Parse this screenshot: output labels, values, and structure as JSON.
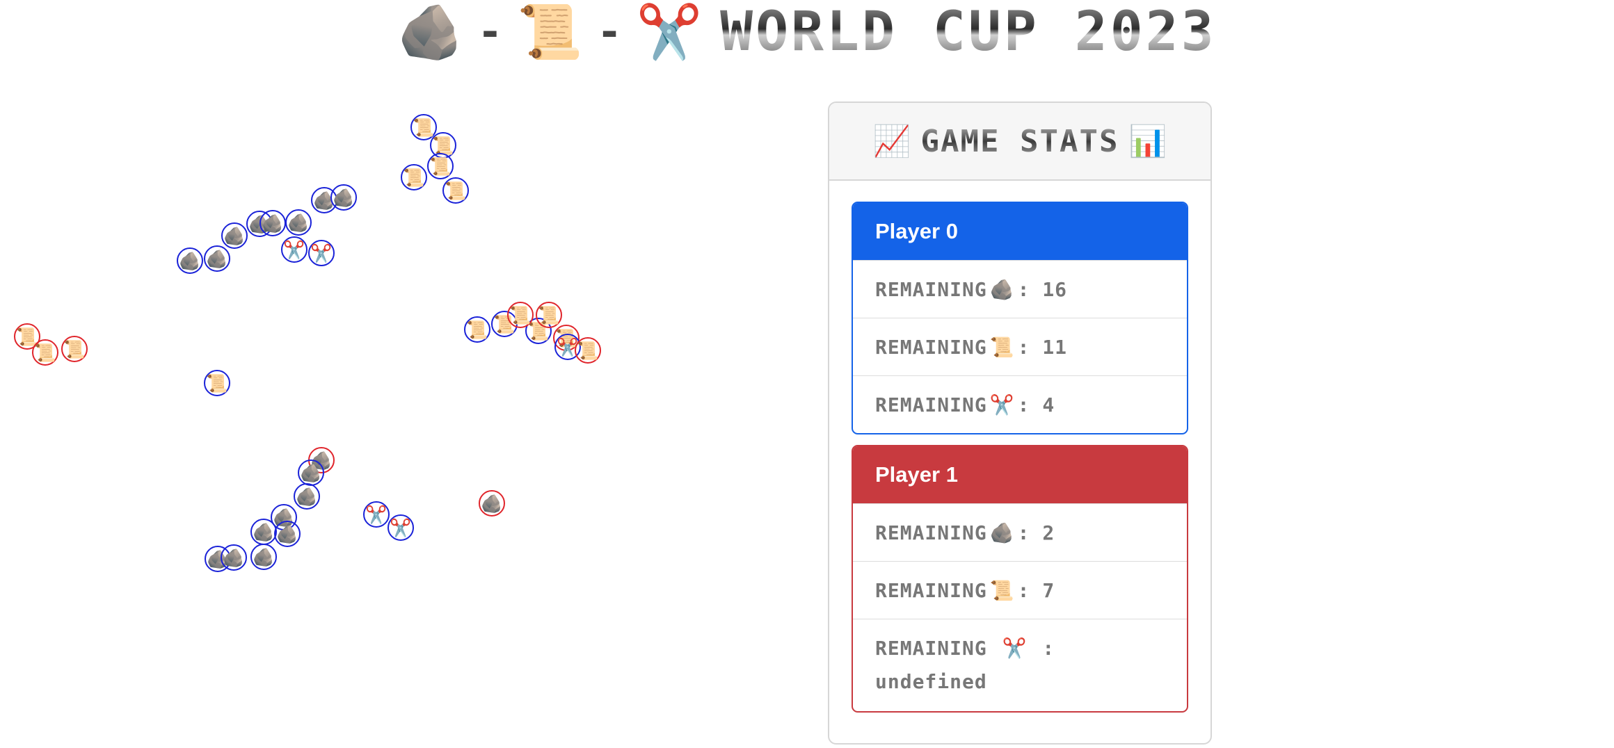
{
  "header": {
    "rock_icon": "🪨",
    "paper_icon": "📜",
    "scissors_icon": "✂️",
    "dash": "-",
    "title_text": "WORLD CUP 2023"
  },
  "stats": {
    "chart_icon": "📈",
    "bars_icon": "📊",
    "title": "GAME STATS",
    "players": [
      {
        "name": "Player 0",
        "color": "#1463e8",
        "rows": [
          {
            "prefix": "REMAINING",
            "icon": "🪨",
            "sep": ":",
            "value": "16"
          },
          {
            "prefix": "REMAINING",
            "icon": "📜",
            "sep": ":",
            "value": "11"
          },
          {
            "prefix": "REMAINING",
            "icon": "✂️",
            "sep": ":",
            "value": "4"
          }
        ]
      },
      {
        "name": "Player 1",
        "color": "#c83a3f",
        "rows": [
          {
            "prefix": "REMAINING",
            "icon": "🪨",
            "sep": ":",
            "value": "2"
          },
          {
            "prefix": "REMAINING",
            "icon": "📜",
            "sep": ":",
            "value": "7"
          },
          {
            "prefix": "REMAINING",
            "icon": "✂️",
            "sep": ":",
            "value": "undefined"
          }
        ]
      }
    ]
  },
  "arena": {
    "player_colors": {
      "p0": "#1a22d8",
      "p1": "#e0252b"
    },
    "pieces": [
      {
        "player": "p0",
        "kind": "rock"
      },
      {
        "player": "p0",
        "kind": "rock"
      },
      {
        "player": "p0",
        "kind": "rock"
      },
      {
        "player": "p0",
        "kind": "rock"
      },
      {
        "player": "p0",
        "kind": "rock"
      },
      {
        "player": "p0",
        "kind": "rock"
      },
      {
        "player": "p0",
        "kind": "rock"
      },
      {
        "player": "p0",
        "kind": "rock"
      },
      {
        "player": "p0",
        "kind": "scissors"
      },
      {
        "player": "p0",
        "kind": "scissors"
      },
      {
        "player": "p0",
        "kind": "paper"
      },
      {
        "player": "p0",
        "kind": "paper"
      },
      {
        "player": "p0",
        "kind": "paper"
      },
      {
        "player": "p0",
        "kind": "paper"
      },
      {
        "player": "p0",
        "kind": "paper"
      },
      {
        "player": "p1",
        "kind": "paper"
      },
      {
        "player": "p1",
        "kind": "paper"
      },
      {
        "player": "p1",
        "kind": "paper"
      },
      {
        "player": "p0",
        "kind": "paper"
      },
      {
        "player": "p0",
        "kind": "paper"
      },
      {
        "player": "p0",
        "kind": "paper"
      },
      {
        "player": "p1",
        "kind": "paper"
      },
      {
        "player": "p1",
        "kind": "paper"
      },
      {
        "player": "p1",
        "kind": "paper"
      },
      {
        "player": "p0",
        "kind": "scissors"
      },
      {
        "player": "p1",
        "kind": "paper"
      },
      {
        "player": "p0",
        "kind": "paper"
      },
      {
        "player": "p1",
        "kind": "rock"
      },
      {
        "player": "p0",
        "kind": "rock"
      },
      {
        "player": "p0",
        "kind": "rock"
      },
      {
        "player": "p0",
        "kind": "rock"
      },
      {
        "player": "p0",
        "kind": "rock"
      },
      {
        "player": "p0",
        "kind": "rock"
      },
      {
        "player": "p0",
        "kind": "rock"
      },
      {
        "player": "p0",
        "kind": "rock"
      },
      {
        "player": "p0",
        "kind": "rock"
      },
      {
        "player": "p0",
        "kind": "scissors"
      },
      {
        "player": "p0",
        "kind": "scissors"
      },
      {
        "player": "p1",
        "kind": "rock"
      }
    ]
  }
}
